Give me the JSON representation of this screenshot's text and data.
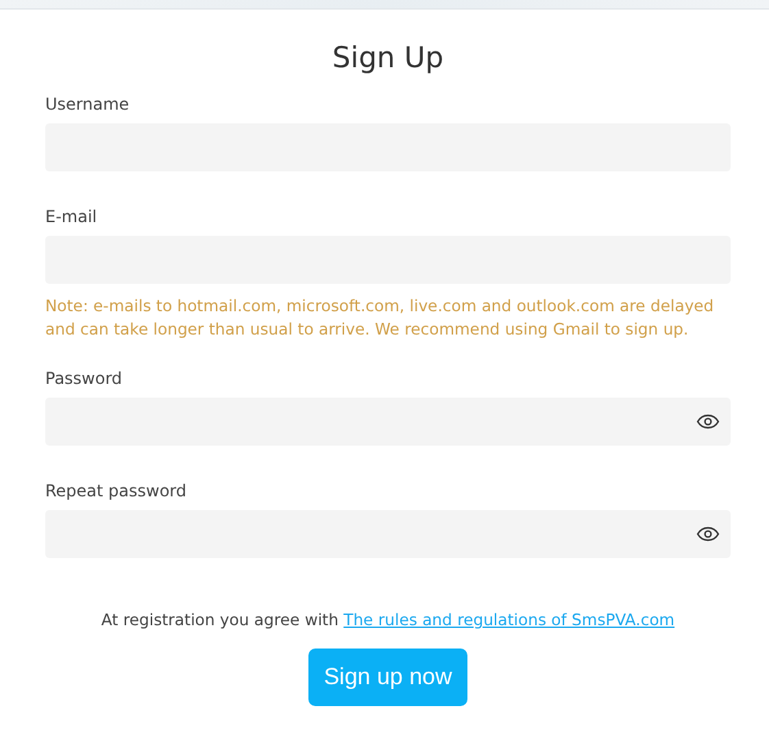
{
  "title": "Sign Up",
  "fields": [
    {
      "label": "Username",
      "kind": "text"
    },
    {
      "label": "E-mail",
      "kind": "text",
      "note": "Note: e-mails to hotmail.com, microsoft.com, live.com and outlook.com are delayed and can take longer than usual to arrive. We recommend using Gmail to sign up."
    },
    {
      "label": "Password",
      "kind": "password"
    },
    {
      "label": "Repeat password",
      "kind": "password"
    }
  ],
  "agreement": {
    "text": "At registration you agree with",
    "link": "The rules and regulations of SmsPVA.com"
  },
  "submit": "Sign up now"
}
